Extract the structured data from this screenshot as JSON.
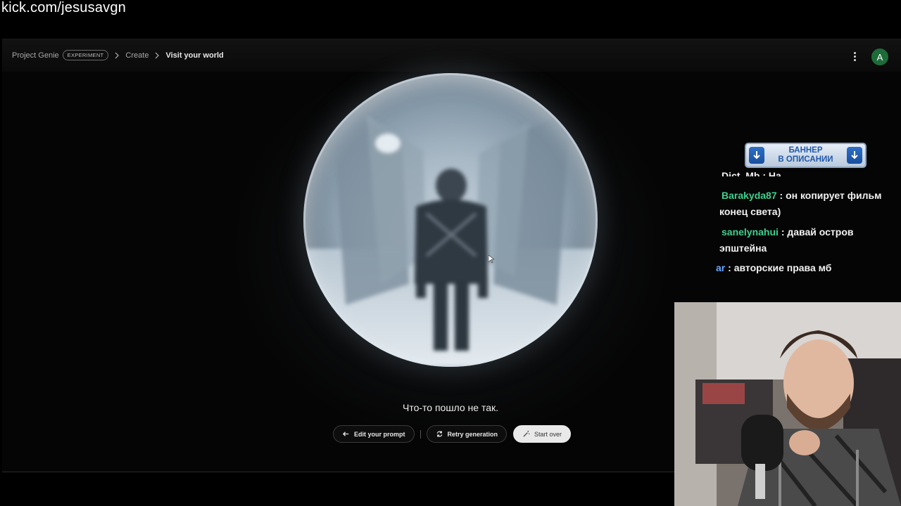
{
  "stream": {
    "url": "kick.com/jesusavgn"
  },
  "app": {
    "breadcrumb": {
      "root": "Project Genie",
      "badge": "EXPERIMENT",
      "create": "Create",
      "current": "Visit your world"
    },
    "menu_icon": "more-vert-icon",
    "avatar_letter": "A",
    "avatar_color": "#1e6b3a"
  },
  "main": {
    "error_message": "Что-то пошло не так.",
    "actions": {
      "edit_prompt": "Edit your prompt",
      "retry": "Retry generation",
      "start_over": "Start over"
    }
  },
  "overlay": {
    "banner": {
      "line1": "БАННЕР",
      "line2": "В ОПИСАНИИ"
    },
    "chat": {
      "cut_line": "Dict_Mb : Ha",
      "messages": [
        {
          "user": "Barakyda87",
          "user_color": "#3fcf8e",
          "text": "он копирует фильм конец света)"
        },
        {
          "user": "sanelynahui",
          "user_color": "#3fcf8e",
          "text": "давай остров эпштейна"
        },
        {
          "user": "ar",
          "user_color": "#6aa7ff",
          "text": "авторские права мб"
        }
      ]
    }
  }
}
